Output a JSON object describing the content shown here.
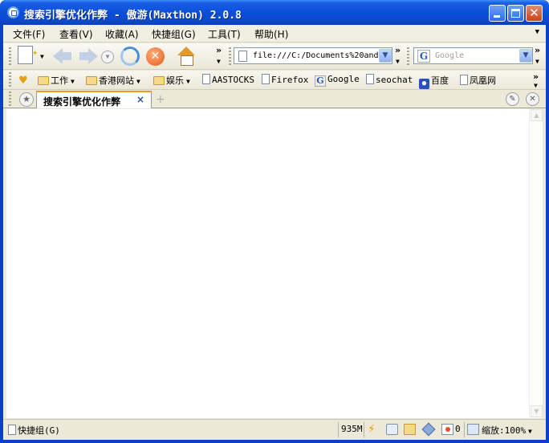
{
  "window": {
    "title": "搜索引擎优化作弊 - 傲游(Maxthon) 2.0.8"
  },
  "menu": {
    "items": [
      "文件(F)",
      "查看(V)",
      "收藏(A)",
      "快捷组(G)",
      "工具(T)",
      "帮助(H)"
    ]
  },
  "toolbar": {
    "overflow": "»"
  },
  "address": {
    "value": "file:///C:/Documents%20and"
  },
  "search": {
    "engine": "G",
    "placeholder": "Google"
  },
  "links": {
    "items": [
      {
        "label": "工作",
        "icon": "folder-icon",
        "menu": true
      },
      {
        "label": "香港网站",
        "icon": "folder-icon",
        "menu": true
      },
      {
        "label": "娱乐",
        "icon": "folder-icon",
        "menu": true
      },
      {
        "label": "AASTOCKS",
        "icon": "page-icon",
        "menu": false
      },
      {
        "label": "Firefox",
        "icon": "page-icon",
        "menu": false
      },
      {
        "label": "Google",
        "icon": "google-icon",
        "menu": false
      },
      {
        "label": "seochat",
        "icon": "page-icon",
        "menu": false
      },
      {
        "label": "百度",
        "icon": "baidu-paw-icon",
        "menu": false
      },
      {
        "label": "凤凰网",
        "icon": "page-icon",
        "menu": false
      }
    ]
  },
  "tabs": {
    "active_title": "搜索引擎优化作弊",
    "close_glyph": "×",
    "new_glyph": "+"
  },
  "status": {
    "left_label": "快捷组(G)",
    "memory": "935M",
    "counter": "0",
    "zoom": "缩放:100%"
  },
  "colors": {
    "titlebar": "#0a4fd8",
    "tab_accent": "#f39a1e",
    "chrome": "#ece9d8"
  }
}
